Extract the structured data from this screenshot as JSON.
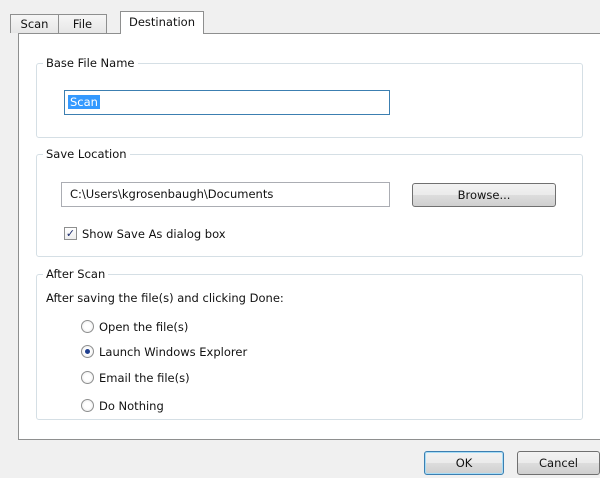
{
  "tabs": [
    {
      "label": "Scan",
      "active": false
    },
    {
      "label": "File",
      "active": false
    },
    {
      "label": "Destination",
      "active": true
    }
  ],
  "base_file_name": {
    "legend": "Base File Name",
    "value": "Scan"
  },
  "save_location": {
    "legend": "Save Location",
    "path": "C:\\Users\\kgrosenbaugh\\Documents",
    "browse_label": "Browse...",
    "show_save_as_label": "Show Save As dialog box",
    "show_save_as_checked": true
  },
  "after_scan": {
    "legend": "After Scan",
    "description": "After saving the file(s) and clicking Done:",
    "options": [
      {
        "label": "Open the file(s)",
        "selected": false
      },
      {
        "label": "Launch Windows Explorer",
        "selected": true
      },
      {
        "label": "Email the file(s)",
        "selected": false
      },
      {
        "label": "Do Nothing",
        "selected": false
      }
    ]
  },
  "footer": {
    "ok_label": "OK",
    "cancel_label": "Cancel"
  }
}
